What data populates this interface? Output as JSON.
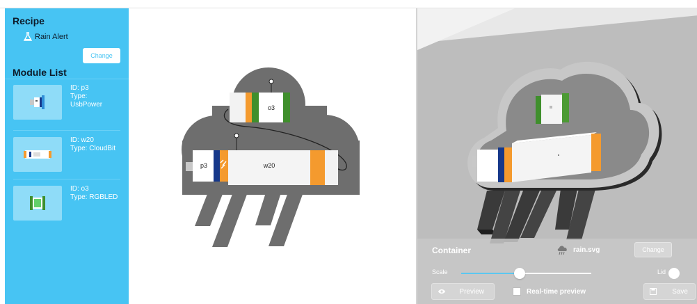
{
  "sidebar": {
    "recipe_heading": "Recipe",
    "recipe_name": "Rain Alert",
    "change_label": "Change",
    "module_heading": "Module List",
    "modules": [
      {
        "id_line": "ID: p3",
        "type_line": "Type:",
        "type_value": "UsbPower"
      },
      {
        "id_line": "ID: w20",
        "type_line": "Type: CloudBit",
        "type_value": ""
      },
      {
        "id_line": "ID: o3",
        "type_line": "Type: RGBLED",
        "type_value": ""
      }
    ]
  },
  "canvas": {
    "blocks": [
      {
        "label": "o3"
      },
      {
        "label": "p3"
      },
      {
        "label": "w20"
      }
    ]
  },
  "preview": {
    "container_label": "Container",
    "file_name": "rain.svg",
    "change_label": "Change",
    "scale_label": "Scale",
    "scale_value": 0.45,
    "lid_label": "Lid",
    "preview_label": "Preview",
    "realtime_label": "Real-time preview",
    "save_label": "Save"
  },
  "colors": {
    "sidebar": "#47c4f3",
    "cloud": "#6e6e6e",
    "orange": "#f49a2e",
    "green": "#3f8f2c",
    "navy": "#16388a"
  }
}
